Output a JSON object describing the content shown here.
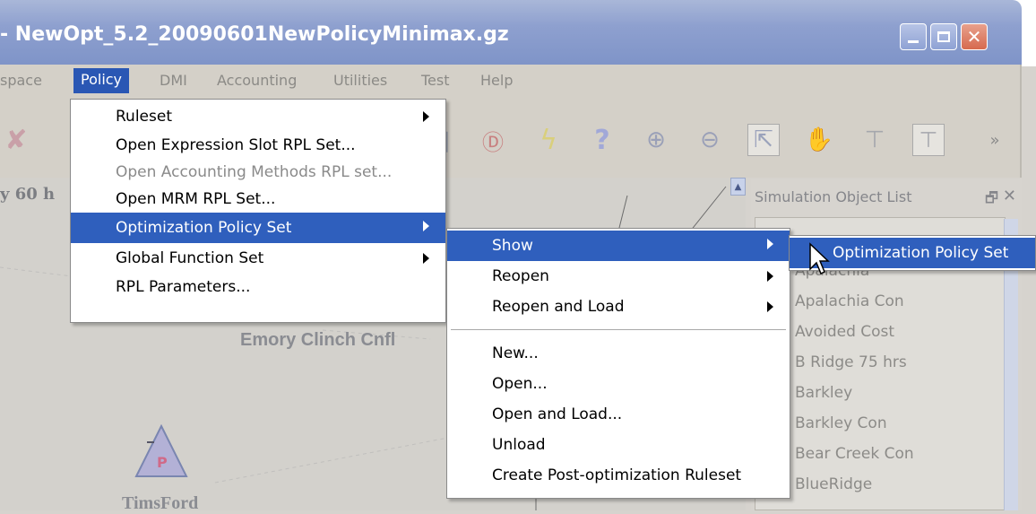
{
  "window": {
    "title": "- NewOpt_5.2_20090601NewPolicyMinimax.gz",
    "controls": {
      "minimize_icon": "minimize-icon",
      "maximize_icon": "maximize-icon",
      "close_icon": "close-icon"
    }
  },
  "menubar": {
    "items": [
      {
        "label": "space"
      },
      {
        "label": "Policy"
      },
      {
        "label": "DMI"
      },
      {
        "label": "Accounting"
      },
      {
        "label": "Utilities"
      },
      {
        "label": "Test"
      },
      {
        "label": "Help"
      }
    ],
    "active": "Policy"
  },
  "toolbar": {
    "tools": [
      "graph-icon",
      "stack-icon",
      "d-icon",
      "lightning-icon",
      "help-icon",
      "zoom-in-icon",
      "zoom-out-icon",
      "pointer-icon",
      "hand-icon",
      "tower-icon",
      "framed-tower-icon"
    ],
    "overflow": "»"
  },
  "workspace": {
    "label_top_left": "y 60 h",
    "label_emory": "Emory Clinch Cnfl",
    "label_tims": "TimsFord",
    "node_letter": "P"
  },
  "panel": {
    "title": "Simulation Object List",
    "pin": "🗗",
    "close": "✕",
    "objects": [
      {
        "label": "Apalachia",
        "icon": "reservoir-icon"
      },
      {
        "label": "Apalachia Con",
        "icon": "table-icon"
      },
      {
        "label": "Avoided Cost",
        "icon": "bar-icon"
      },
      {
        "label": "B Ridge 75 hrs",
        "icon": "curve-icon"
      },
      {
        "label": "Barkley",
        "icon": "reservoir-icon"
      },
      {
        "label": "Barkley Con",
        "icon": "table-icon"
      },
      {
        "label": "Bear Creek Con",
        "icon": "table-icon"
      },
      {
        "label": "BlueRidge",
        "icon": "reservoir-icon"
      }
    ]
  },
  "policy_menu": {
    "items": [
      {
        "label": "Ruleset",
        "submenu": true,
        "disabled": false
      },
      {
        "label": "Open Expression Slot RPL Set...",
        "submenu": false,
        "disabled": false
      },
      {
        "label": "Open Accounting Methods RPL set...",
        "submenu": false,
        "disabled": true
      },
      {
        "label": "Open MRM RPL Set...",
        "submenu": false,
        "disabled": false
      },
      {
        "label": "Optimization Policy Set",
        "submenu": true,
        "disabled": false,
        "highlighted": true
      },
      {
        "label": "Global Function Set",
        "submenu": true,
        "disabled": false
      },
      {
        "label": "RPL Parameters...",
        "submenu": false,
        "disabled": false
      }
    ]
  },
  "opt_policy_submenu": {
    "items": [
      {
        "label": "Show",
        "submenu": true,
        "highlighted": true
      },
      {
        "label": "Reopen",
        "submenu": true
      },
      {
        "label": "Reopen and Load",
        "submenu": true
      },
      {
        "label": "New...",
        "submenu": false
      },
      {
        "label": "Open...",
        "submenu": false
      },
      {
        "label": "Open and Load...",
        "submenu": false
      },
      {
        "label": "Unload",
        "submenu": false
      },
      {
        "label": "Create Post-optimization Ruleset",
        "submenu": false
      }
    ]
  },
  "show_submenu": {
    "items": [
      {
        "label": "Optimization Policy Set",
        "highlighted": true
      }
    ]
  },
  "colors": {
    "menu_highlight": "#2f5fbd",
    "titlebar": "#8ea0cf"
  }
}
